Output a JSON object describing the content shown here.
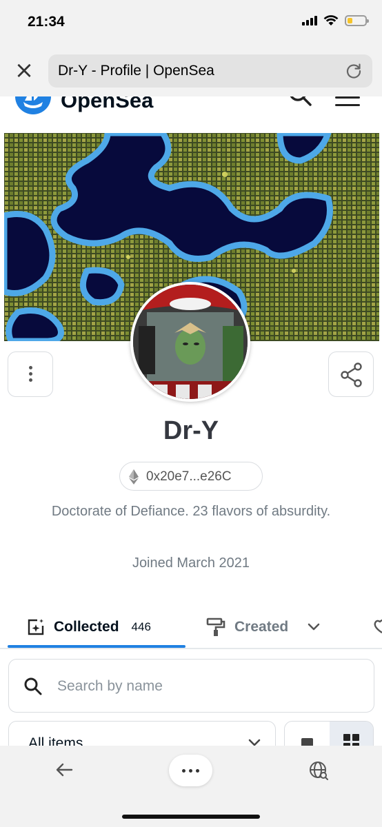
{
  "status_bar": {
    "time": "21:34",
    "battery_level": 0.3
  },
  "browser": {
    "page_title": "Dr-Y - Profile | OpenSea",
    "close_icon": "close-icon",
    "reload_icon": "reload-icon"
  },
  "site_header": {
    "logo_text": "OpenSea",
    "brand_color": "#2081e2"
  },
  "profile": {
    "name": "Dr-Y",
    "address": "0x20e7...e26C",
    "bio": "Doctorate of Defiance. 23 flavors of absurdity.",
    "joined": "Joined March 2021"
  },
  "tabs": [
    {
      "label": "Collected",
      "count": "446",
      "active": true,
      "icon": "sparkle-frame-icon"
    },
    {
      "label": "Created",
      "active": false,
      "icon": "paint-roller-icon"
    }
  ],
  "search": {
    "placeholder": "Search by name"
  },
  "filters": {
    "dropdown_value": "All items",
    "view_mode": "grid"
  },
  "colors": {
    "text_primary": "#04111d",
    "text_secondary": "#707a83",
    "accent": "#2081e2"
  }
}
